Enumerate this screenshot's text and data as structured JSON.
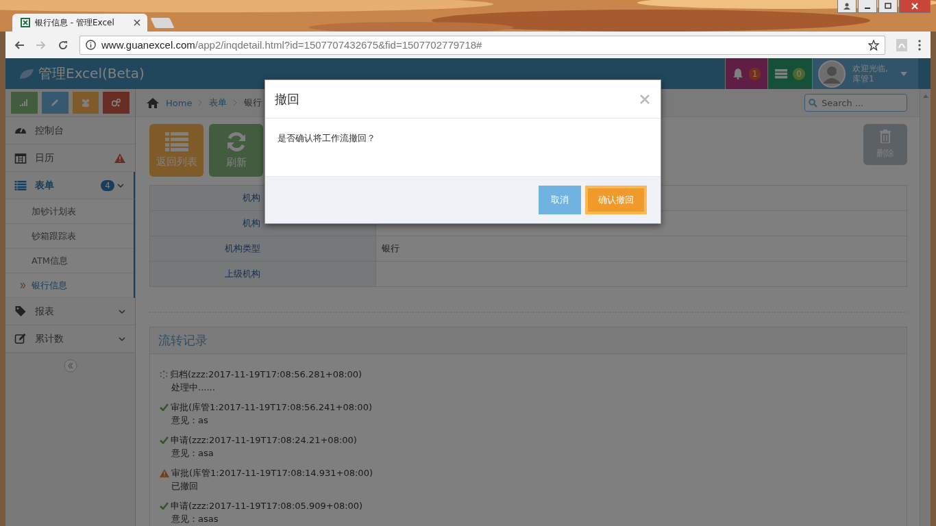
{
  "browser": {
    "tab_title": "银行信息 - 管理Excel",
    "url_host": "www.guanexcel.com",
    "url_path": "/app2/inqdetail.html?id=1507707432675&fid=1507702779718#"
  },
  "header": {
    "brand": "管理Excel(Beta)",
    "notifications": "1",
    "tasks": "0",
    "welcome": "欢迎光临,",
    "user": "库管1"
  },
  "sidebar": {
    "items": [
      {
        "label": "控制台",
        "kind": "dashboard",
        "selected": false,
        "alert": false,
        "has_menu": false
      },
      {
        "label": "日历",
        "kind": "calendar",
        "selected": false,
        "alert": true,
        "has_menu": false
      },
      {
        "label": "表单",
        "kind": "list",
        "selected": true,
        "alert": false,
        "has_menu": true,
        "badge": "4",
        "children": [
          {
            "label": "加钞计划表",
            "selected": false
          },
          {
            "label": "钞箱跟踪表",
            "selected": false
          },
          {
            "label": "ATM信息",
            "selected": false
          },
          {
            "label": "银行信息",
            "selected": true
          }
        ]
      },
      {
        "label": "报表",
        "kind": "tag",
        "selected": false,
        "alert": false,
        "has_menu": true
      },
      {
        "label": "累计数",
        "kind": "edit",
        "selected": false,
        "alert": false,
        "has_menu": true
      }
    ]
  },
  "breadcrumb": [
    "Home",
    "表单",
    "银行"
  ],
  "search": {
    "placeholder": "Search ..."
  },
  "actions": [
    {
      "label": "返回列表",
      "kind": "list"
    },
    {
      "label": "刷新",
      "kind": "refresh"
    }
  ],
  "delete_button": {
    "label": "删除",
    "disabled": true
  },
  "details": [
    {
      "label": "机构"
    },
    {
      "label": "机构"
    },
    {
      "label": "机构类型",
      "value": "银行"
    },
    {
      "label": "上级机构"
    }
  ],
  "history": {
    "title": "流转记录",
    "entries": [
      {
        "kind": "pending",
        "title": "归档(zzz:2017-11-19T17:08:56.281+08:00)",
        "note": "处理中......"
      },
      {
        "kind": "done",
        "title": "审批(库管1:2017-11-19T17:08:56.241+08:00)",
        "note": "意见：as"
      },
      {
        "kind": "done",
        "title": "申请(zzz:2017-11-19T17:08:24.21+08:00)",
        "note": "意见：asa"
      },
      {
        "kind": "warning",
        "title": "审批(库管1:2017-11-19T17:08:14.931+08:00)",
        "note": "已撤回"
      },
      {
        "kind": "done",
        "title": "申请(zzz:2017-11-19T17:08:05.909+08:00)",
        "note": "意见：asas"
      }
    ]
  },
  "modal": {
    "title": "撤回",
    "message": "是否确认将工作流撤回？",
    "cancel": "取消",
    "confirm": "确认撤回"
  }
}
